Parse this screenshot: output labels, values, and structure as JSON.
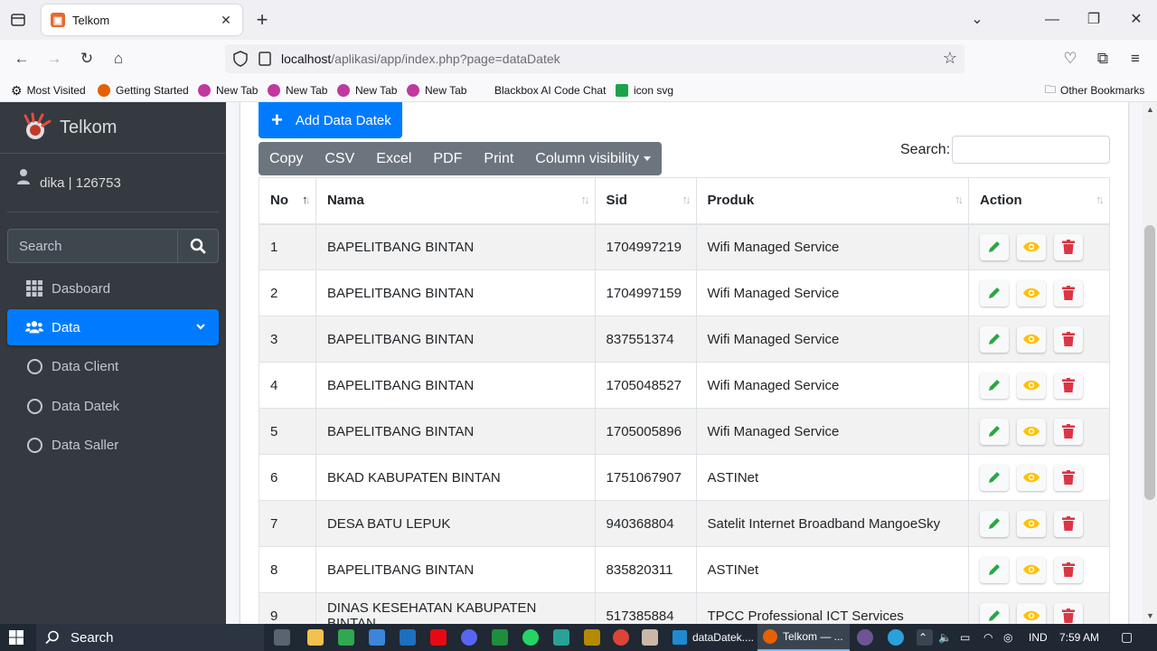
{
  "browser": {
    "tab_title": "Telkom",
    "url_host": "localhost",
    "url_path": "/aplikasi/app/index.php?page=dataDatek",
    "bookmarks": [
      {
        "label": "Most Visited",
        "icon": "gear-icon"
      },
      {
        "label": "Getting Started",
        "icon": "firefox-icon"
      },
      {
        "label": "New Tab",
        "icon": "firefox-icon"
      },
      {
        "label": "New Tab",
        "icon": "firefox-icon"
      },
      {
        "label": "New Tab",
        "icon": "firefox-icon"
      },
      {
        "label": "New Tab",
        "icon": "firefox-icon"
      },
      {
        "label": "Blackbox AI Code Chat",
        "icon": "blackbox-icon"
      },
      {
        "label": "icon svg",
        "icon": "svg-icon"
      }
    ],
    "other_bookmarks": "Other Bookmarks"
  },
  "sidebar": {
    "brand": "Telkom",
    "user": "dika | 126753",
    "search_placeholder": "Search",
    "items": [
      {
        "label": "Dasboard",
        "icon": "grid-icon"
      },
      {
        "label": "Data",
        "icon": "users-icon",
        "active": true
      },
      {
        "label": "Data Client",
        "icon": "circle-icon"
      },
      {
        "label": "Data Datek",
        "icon": "circle-icon"
      },
      {
        "label": "Data Saller",
        "icon": "circle-icon"
      }
    ]
  },
  "main": {
    "add_button": "Add Data Datek",
    "export_buttons": [
      "Copy",
      "CSV",
      "Excel",
      "PDF",
      "Print",
      "Column visibility"
    ],
    "search_label": "Search:",
    "columns": [
      "No",
      "Nama",
      "Sid",
      "Produk",
      "Action"
    ],
    "rows": [
      {
        "no": "1",
        "nama": "BAPELITBANG BINTAN",
        "sid": "1704997219",
        "produk": "Wifi Managed Service"
      },
      {
        "no": "2",
        "nama": "BAPELITBANG BINTAN",
        "sid": "1704997159",
        "produk": "Wifi Managed Service"
      },
      {
        "no": "3",
        "nama": "BAPELITBANG BINTAN",
        "sid": "837551374",
        "produk": "Wifi Managed Service"
      },
      {
        "no": "4",
        "nama": "BAPELITBANG BINTAN",
        "sid": "1705048527",
        "produk": "Wifi Managed Service"
      },
      {
        "no": "5",
        "nama": "BAPELITBANG BINTAN",
        "sid": "1705005896",
        "produk": "Wifi Managed Service"
      },
      {
        "no": "6",
        "nama": "BKAD KABUPATEN BINTAN",
        "sid": "1751067907",
        "produk": "ASTINet"
      },
      {
        "no": "7",
        "nama": "DESA BATU LEPUK",
        "sid": "940368804",
        "produk": "Satelit Internet Broadband MangoeSky"
      },
      {
        "no": "8",
        "nama": "BAPELITBANG BINTAN",
        "sid": "835820311",
        "produk": "ASTINet"
      },
      {
        "no": "9",
        "nama": "DINAS KESEHATAN KABUPATEN BINTAN",
        "sid": "517385884",
        "produk": "TPCC Professional ICT Services"
      }
    ]
  },
  "taskbar": {
    "search": "Search",
    "apps": [
      "dataDatek....",
      "Telkom — ..."
    ],
    "lang": "IND",
    "time": "7:59 AM"
  },
  "colors": {
    "primary": "#007bff",
    "sidebar_bg": "#343a40",
    "edit": "#28a745",
    "view": "#ffc107",
    "delete": "#dc3545"
  }
}
